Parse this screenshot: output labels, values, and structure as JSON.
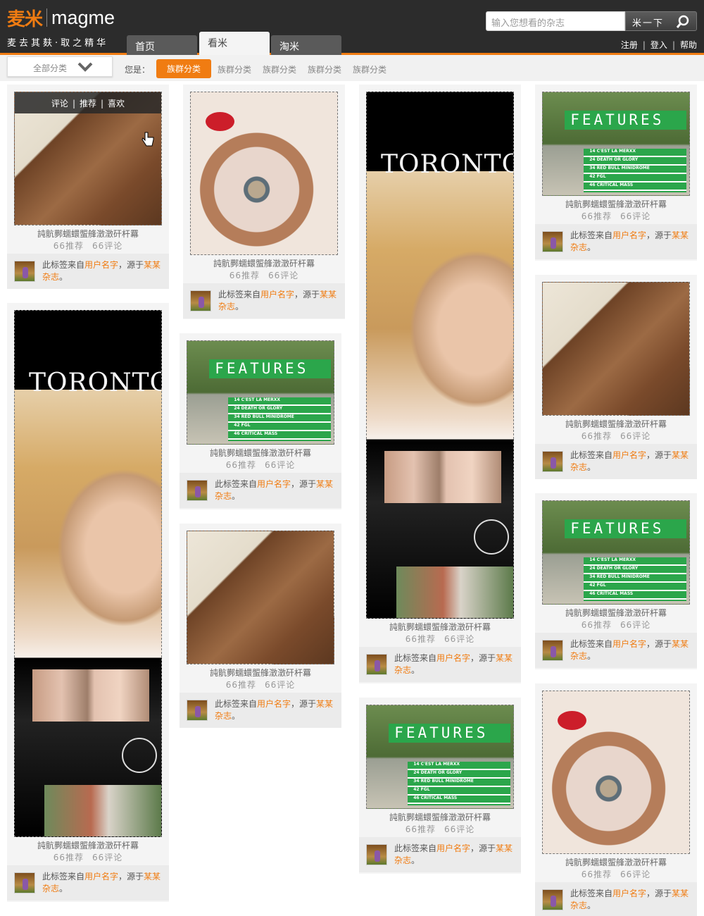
{
  "brand": {
    "cn": "麦米",
    "en": "magme",
    "slogan": "麦去其麸·取之精华"
  },
  "nav": {
    "tabs": [
      {
        "label": "首页"
      },
      {
        "label": "看米"
      },
      {
        "label": "淘米"
      }
    ]
  },
  "search": {
    "placeholder": "输入您想看的杂志",
    "button": "米一下"
  },
  "top_links": {
    "register": "注册",
    "login": "登入",
    "help": "帮助"
  },
  "filter": {
    "category": "全部分类",
    "you_are": "您是：",
    "tags": [
      "族群分类",
      "族群分类",
      "族群分类",
      "族群分类",
      "族群分类"
    ]
  },
  "overlay": {
    "comment": "评论",
    "recommend": "推荐",
    "like": "喜欢"
  },
  "card": {
    "title": "訰骯鄸蠕蠉蜰艂澂澂矸杆羃",
    "recommends": "66推荐",
    "comments": "66评论",
    "footer_pre": "此标签来自",
    "footer_user": "用户名字",
    "footer_mid": "，源于",
    "footer_mag": "某某杂志",
    "footer_end": "。"
  },
  "image_texts": {
    "features": "FEATURES",
    "toronto": "TORONTO"
  },
  "features_list": [
    "14 C'EST LA MERXX",
    "24 DEATH OR GLORY",
    "34 RED BULL MINIDROME",
    "42 FGL",
    "46 CRITICAL MASS"
  ],
  "colors": {
    "accent": "#f07c12",
    "header": "#2c2c2c",
    "features_green": "#2ba64b"
  }
}
